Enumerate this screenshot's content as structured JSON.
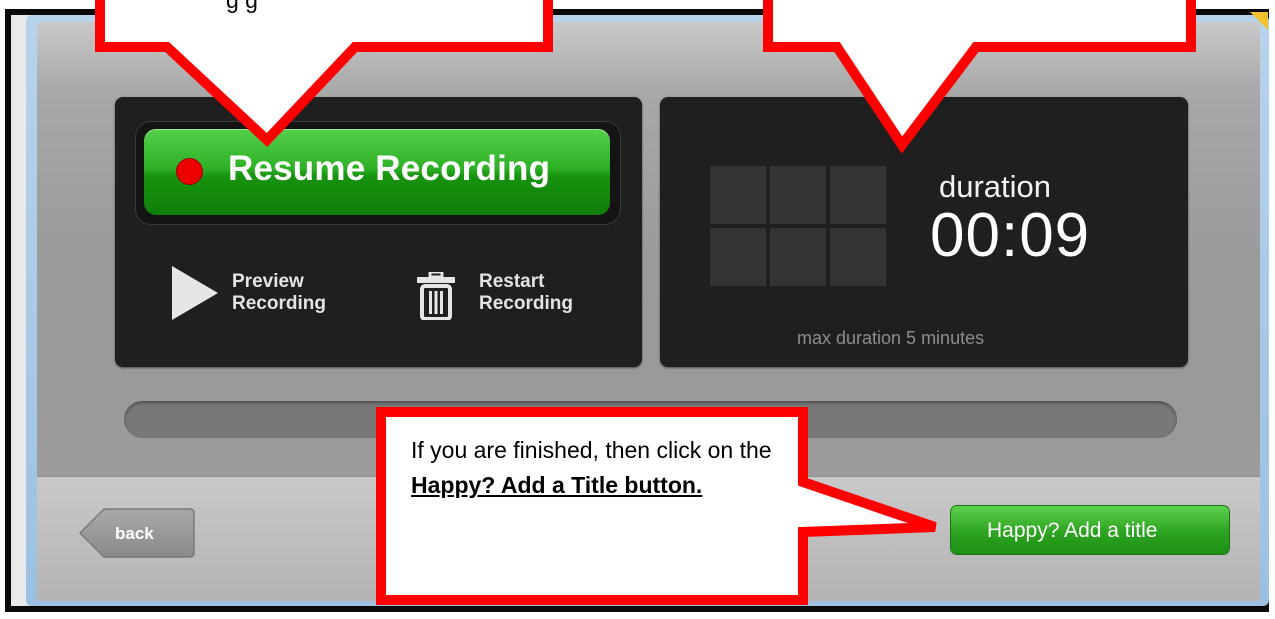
{
  "recorder": {
    "resume_label": "Resume Recording",
    "preview_label": "Preview\nRecording",
    "restart_label": "Restart\nRecording",
    "duration_label": "duration",
    "duration_value": "00:09",
    "max_duration": "max duration 5 minutes",
    "progress": 0
  },
  "footer": {
    "back_label": "back",
    "happy_label": "Happy? Add a title"
  },
  "callouts": {
    "top_left_partial": "g  g",
    "bottom_part1": "If you are finished, then click on the ",
    "bottom_highlight": "Happy?  Add a Title button."
  },
  "icons": {
    "record": "record-dot-icon",
    "preview": "play-icon",
    "restart": "trash-icon",
    "back": "back-arrow-icon"
  },
  "colors": {
    "callout_border": "#ff0000",
    "primary_green": "#2fb128",
    "record_red": "#e00000",
    "panel_bg": "#1f1f1f"
  }
}
